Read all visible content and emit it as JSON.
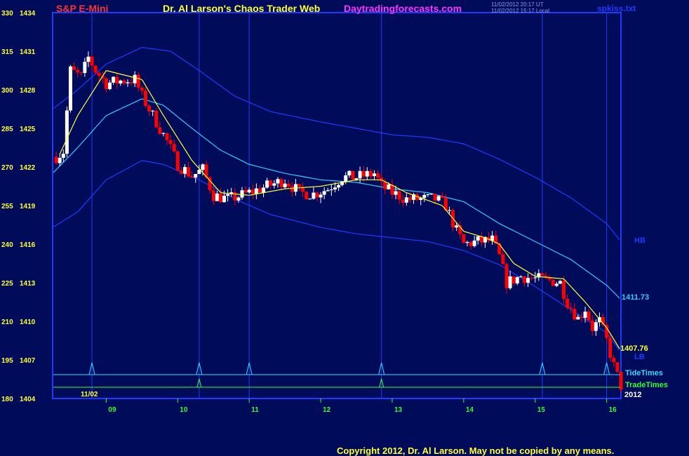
{
  "header": {
    "symbol": "S&P E-Mini",
    "title": "Dr. Al Larson's Chaos Trader Web",
    "site": "Daytradingforecasts.com",
    "time_ut": "11/02/2012 20:17 UT",
    "time_local": "11/02/2012 15:17 Local",
    "file": "spkiss.txt"
  },
  "footer": {
    "copyright": "Copyright 2012, Dr. Al Larson. May not be copied by any means."
  },
  "colors": {
    "background": "#000b5a",
    "up_candle": "#ffffff",
    "down_candle": "#ff0000",
    "ema": "#ffff33",
    "mid_band": "#33ccff",
    "outer_band": "#1e3cff",
    "tide": "#33ddff",
    "trade": "#33ff33",
    "price_axis": "#ffff33",
    "time_axis": "#33ff33"
  },
  "chart_data": {
    "type": "candlestick",
    "title": "S&P E-Mini",
    "date_label": "11/02",
    "year_label": "2012",
    "y_axis_left": {
      "ticks": [
        330,
        315,
        300,
        285,
        270,
        255,
        240,
        225,
        210,
        195,
        180
      ],
      "price_ticks": [
        1434,
        1431,
        1428,
        1425,
        1422,
        1419,
        1416,
        1413,
        1410,
        1407,
        1404
      ]
    },
    "price_range": [
      1404,
      1434
    ],
    "x_ticks": [
      "09",
      "10",
      "11",
      "12",
      "13",
      "14",
      "15",
      "16"
    ],
    "x_range_hours": [
      8.25,
      16.2
    ],
    "timing_lines_hours": [
      8.8,
      10.3,
      11.0,
      12.85,
      15.1,
      16.0
    ],
    "tide_times_hours": [
      8.8,
      10.3,
      11.0,
      12.85,
      15.1,
      16.0
    ],
    "trade_times_hours": [
      10.3,
      12.85
    ],
    "labels": {
      "hb": "HB",
      "lb": "LB",
      "mid_value": "1411.73",
      "last_value": "1407.76",
      "tide": "TideTimes",
      "trade": "TradeTimes"
    },
    "series": [
      {
        "name": "candles",
        "anchors_hours": [
          8.3,
          8.4,
          8.5,
          8.65,
          8.75,
          8.85,
          9.0,
          9.2,
          9.4,
          9.5,
          9.7,
          9.85,
          10.0,
          10.2,
          10.35,
          10.5,
          10.7,
          10.9,
          11.1,
          11.3,
          11.5,
          11.7,
          11.9,
          12.1,
          12.3,
          12.5,
          12.75,
          12.85,
          13.0,
          13.2,
          13.4,
          13.6,
          13.75,
          13.9,
          14.0,
          14.2,
          14.4,
          14.5,
          14.6,
          14.8,
          15.0,
          15.2,
          15.35,
          15.45,
          15.6,
          15.7,
          15.8,
          15.9,
          16.0,
          16.1,
          16.2
        ],
        "anchors_close": [
          1422.8,
          1423.2,
          1429.5,
          1429.0,
          1430.5,
          1429.5,
          1428.5,
          1428.7,
          1428.8,
          1427.5,
          1425.5,
          1424.0,
          1422.2,
          1421.3,
          1421.8,
          1419.8,
          1419.5,
          1419.8,
          1420.2,
          1420.6,
          1421.0,
          1420.0,
          1419.9,
          1420.3,
          1421.2,
          1421.2,
          1421.5,
          1420.5,
          1420.0,
          1419.5,
          1419.5,
          1419.5,
          1419.0,
          1417.0,
          1416.0,
          1416.2,
          1416.3,
          1415.0,
          1413.0,
          1413.5,
          1413.3,
          1413.2,
          1413.0,
          1411.5,
          1410.2,
          1411.0,
          1409.5,
          1410.0,
          1408.5,
          1406.5,
          1405.0
        ]
      },
      {
        "name": "ema",
        "anchors_hours": [
          8.35,
          8.6,
          9.0,
          9.5,
          9.8,
          10.2,
          10.6,
          11.0,
          11.5,
          12.0,
          12.5,
          12.85,
          13.2,
          13.7,
          14.0,
          14.3,
          14.5,
          14.7,
          15.0,
          15.4,
          15.7,
          16.0,
          16.2
        ],
        "anchors_price": [
          1423.0,
          1426.0,
          1429.5,
          1428.8,
          1426.0,
          1422.5,
          1420.0,
          1419.8,
          1420.3,
          1420.5,
          1421.0,
          1421.0,
          1420.0,
          1419.0,
          1417.0,
          1416.5,
          1416.0,
          1414.5,
          1413.5,
          1413.3,
          1411.5,
          1409.5,
          1407.7
        ]
      },
      {
        "name": "mid_band",
        "anchors_hours": [
          8.25,
          8.6,
          9.0,
          9.5,
          9.8,
          10.2,
          10.6,
          11.0,
          11.5,
          12.0,
          12.5,
          13.0,
          13.5,
          14.0,
          14.5,
          15.0,
          15.5,
          16.0,
          16.2
        ],
        "anchors_price": [
          1421.5,
          1423.5,
          1426.0,
          1427.3,
          1426.8,
          1425.0,
          1423.3,
          1422.2,
          1421.5,
          1421.0,
          1420.8,
          1420.3,
          1420.0,
          1419.3,
          1417.6,
          1416.2,
          1414.8,
          1412.8,
          1411.7
        ]
      },
      {
        "name": "upper_band",
        "anchors_hours": [
          8.25,
          8.6,
          9.0,
          9.5,
          9.9,
          10.3,
          10.8,
          11.3,
          12.0,
          12.5,
          13.0,
          13.5,
          14.0,
          14.5,
          15.0,
          15.5,
          16.0,
          16.2
        ],
        "anchors_price": [
          1426.5,
          1428.0,
          1430.0,
          1431.3,
          1431.0,
          1429.5,
          1427.5,
          1426.3,
          1425.5,
          1425.0,
          1424.5,
          1424.3,
          1423.8,
          1422.6,
          1421.2,
          1419.6,
          1417.6,
          1416.2
        ]
      },
      {
        "name": "lower_band",
        "anchors_hours": [
          8.25,
          8.6,
          9.0,
          9.5,
          9.8,
          10.3,
          10.8,
          11.3,
          12.0,
          12.5,
          13.0,
          13.5,
          14.0,
          14.5,
          15.0,
          15.5,
          16.0,
          16.2
        ],
        "anchors_price": [
          1417.3,
          1418.5,
          1421.0,
          1422.5,
          1422.2,
          1421.0,
          1419.5,
          1418.3,
          1417.3,
          1416.8,
          1416.5,
          1416.2,
          1415.5,
          1414.4,
          1412.7,
          1410.9,
          1409.1,
          1407.6
        ]
      }
    ]
  }
}
